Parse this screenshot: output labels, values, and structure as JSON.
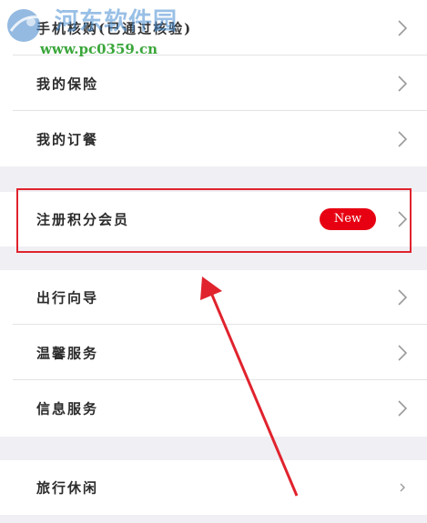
{
  "group1": {
    "items": [
      {
        "label": "手机核购(已通过核验)"
      },
      {
        "label": "我的保险"
      },
      {
        "label": "我的订餐"
      }
    ]
  },
  "group2": {
    "items": [
      {
        "label": "注册积分会员",
        "badge": "New"
      }
    ]
  },
  "group3": {
    "items": [
      {
        "label": "出行向导"
      },
      {
        "label": "温馨服务"
      },
      {
        "label": "信息服务"
      }
    ]
  },
  "group4": {
    "items": [
      {
        "label": "旅行休闲"
      }
    ]
  },
  "watermark": {
    "title": "河东软件园",
    "url": "www.pc0359.cn"
  },
  "colors": {
    "badge": "#e60012",
    "highlight_box": "#e0232d",
    "arrow": "#e0232d",
    "background": "#efeff4"
  },
  "icons": {
    "chevron": "chevron-right-icon"
  }
}
